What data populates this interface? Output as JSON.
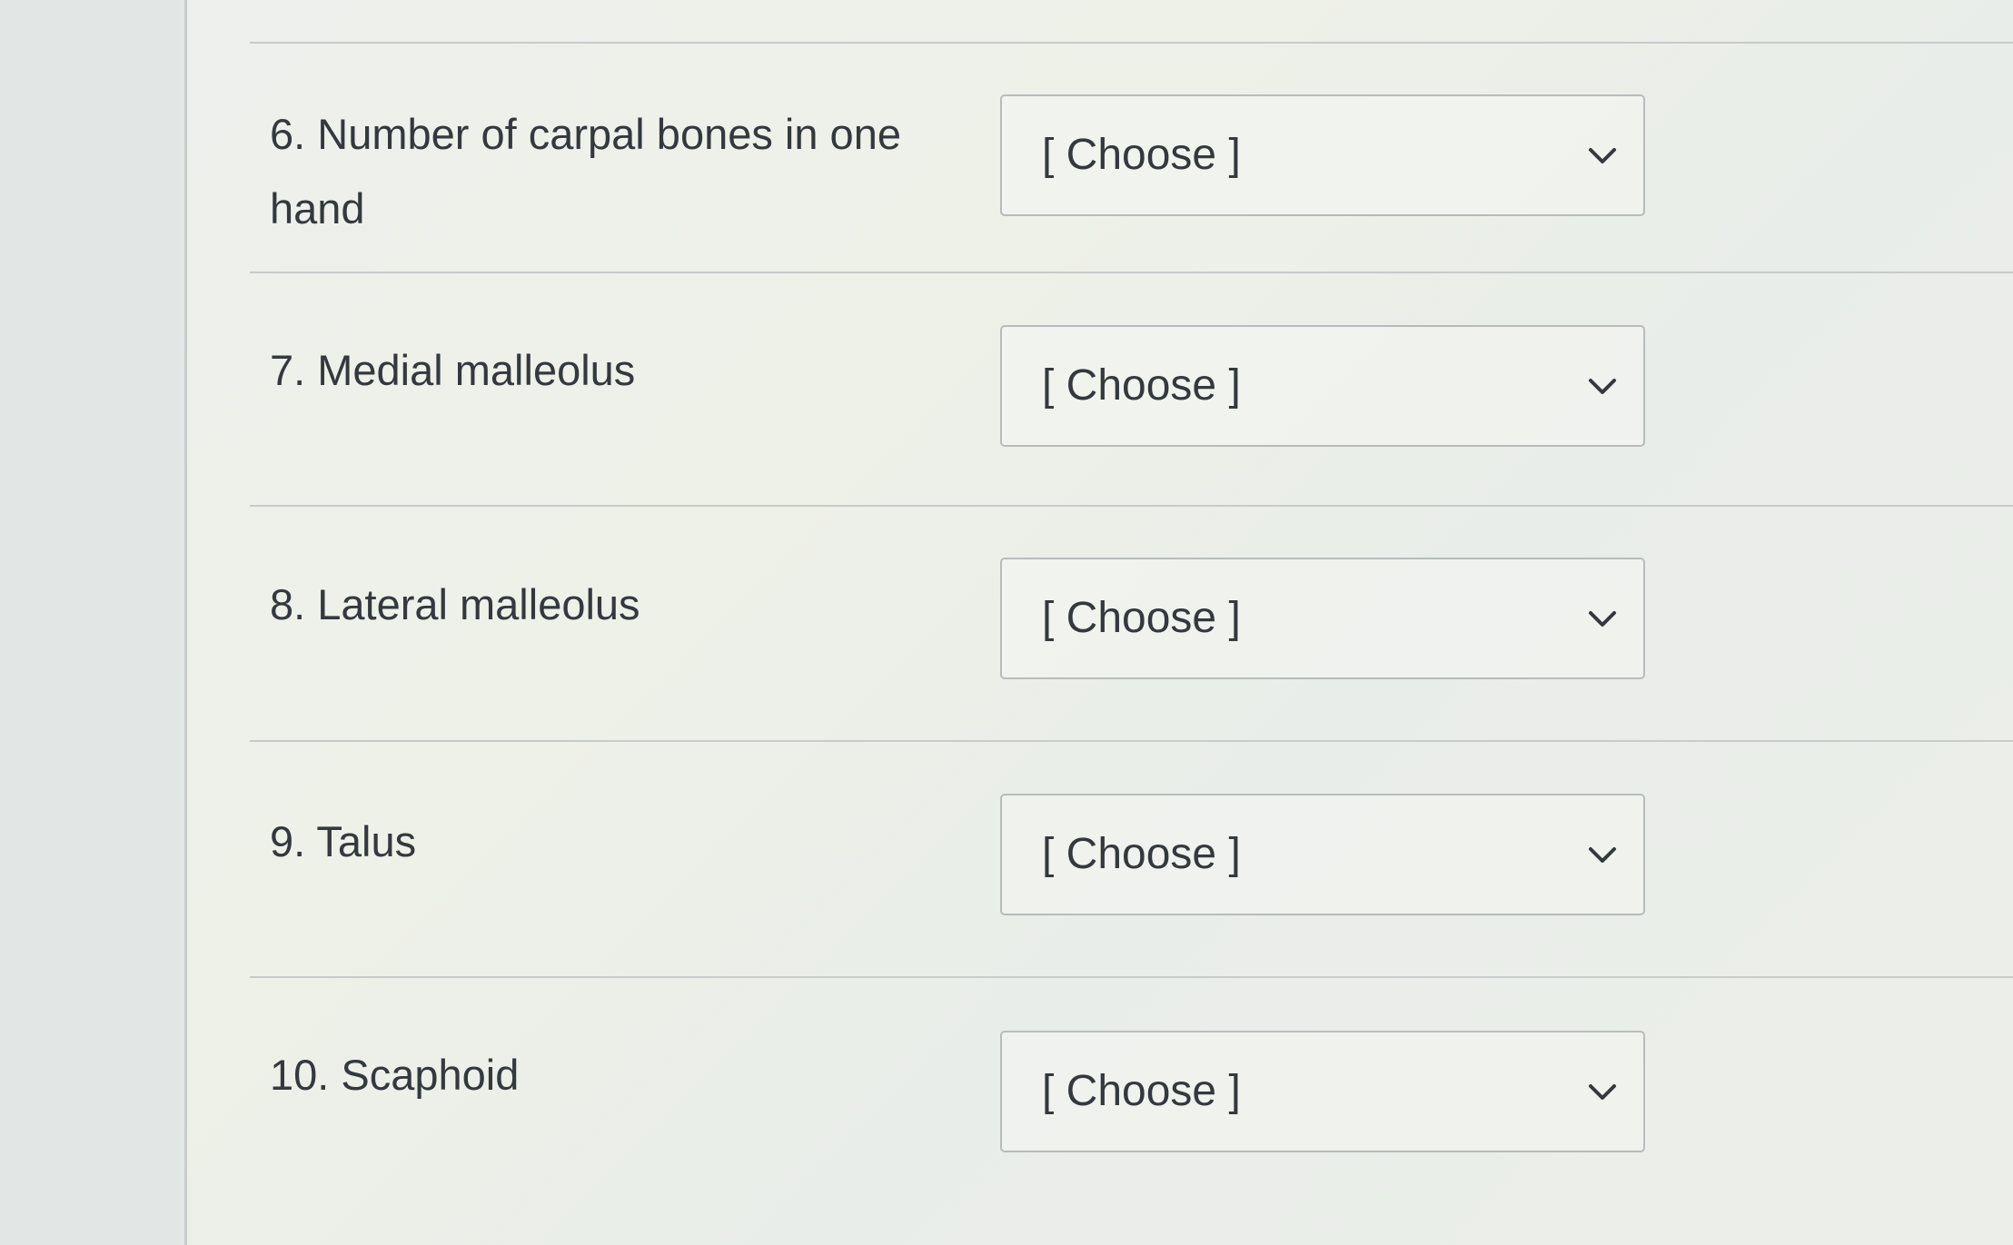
{
  "questions": [
    {
      "label": "6. Number of carpal bones in one hand",
      "select_value": "[ Choose ]"
    },
    {
      "label": "7. Medial malleolus",
      "select_value": "[ Choose ]"
    },
    {
      "label": "8. Lateral malleolus",
      "select_value": "[ Choose ]"
    },
    {
      "label": "9. Talus",
      "select_value": "[ Choose ]"
    },
    {
      "label": "10. Scaphoid",
      "select_value": "[ Choose ]"
    }
  ],
  "icons": {
    "dropdown": "chevron-down-icon"
  },
  "colors": {
    "text": "#33393d",
    "border": "#b7bcbc",
    "divider": "#c7cbca"
  }
}
